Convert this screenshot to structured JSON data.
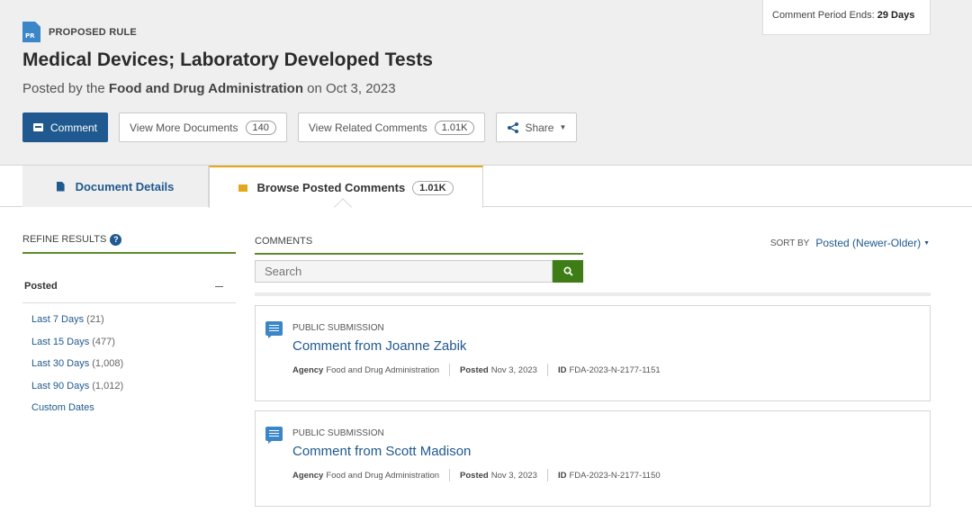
{
  "header": {
    "doc_type_icon_text": "PR",
    "doc_type": "PROPOSED RULE",
    "title": "Medical Devices; Laboratory Developed Tests",
    "posted_prefix": "Posted by the",
    "agency": "Food and Drug Administration",
    "posted_suffix": "on Oct 3, 2023",
    "period_label": "Comment Period Ends:",
    "period_value": "29 Days"
  },
  "actions": {
    "comment": "Comment",
    "more_docs": "View More Documents",
    "more_docs_count": "140",
    "related_comments": "View Related Comments",
    "related_count": "1.01K",
    "share": "Share"
  },
  "tabs": {
    "details": "Document Details",
    "browse": "Browse Posted Comments",
    "browse_count": "1.01K"
  },
  "sidebar": {
    "refine": "REFINE RESULTS",
    "facet": "Posted",
    "items": [
      {
        "label": "Last 7 Days",
        "count": "(21)"
      },
      {
        "label": "Last 15 Days",
        "count": "(477)"
      },
      {
        "label": "Last 30 Days",
        "count": "(1,008)"
      },
      {
        "label": "Last 90 Days",
        "count": "(1,012)"
      },
      {
        "label": "Custom Dates",
        "count": ""
      }
    ]
  },
  "comments": {
    "heading": "COMMENTS",
    "search_placeholder": "Search",
    "sort_label": "SORT BY",
    "sort_value": "Posted (Newer-Older)",
    "items": [
      {
        "type": "PUBLIC SUBMISSION",
        "title": "Comment from Joanne Zabik",
        "agency_label": "Agency",
        "agency": "Food and Drug Administration",
        "posted_label": "Posted",
        "posted": "Nov 3, 2023",
        "id_label": "ID",
        "id": "FDA-2023-N-2177-1151"
      },
      {
        "type": "PUBLIC SUBMISSION",
        "title": "Comment from Scott Madison",
        "agency_label": "Agency",
        "agency": "Food and Drug Administration",
        "posted_label": "Posted",
        "posted": "Nov 3, 2023",
        "id_label": "ID",
        "id": "FDA-2023-N-2177-1150"
      }
    ]
  },
  "colors": {
    "primary": "#20598f",
    "accent_green": "#3e7c16",
    "tab_accent": "#e3a81a",
    "icon_blue": "#3a86c8"
  },
  "icons": [
    "proposed-rule-doc-icon",
    "comment-icon",
    "share-icon",
    "document-icon",
    "comment-flag-icon",
    "help-icon",
    "search-icon",
    "comment-bubble-icon"
  ]
}
